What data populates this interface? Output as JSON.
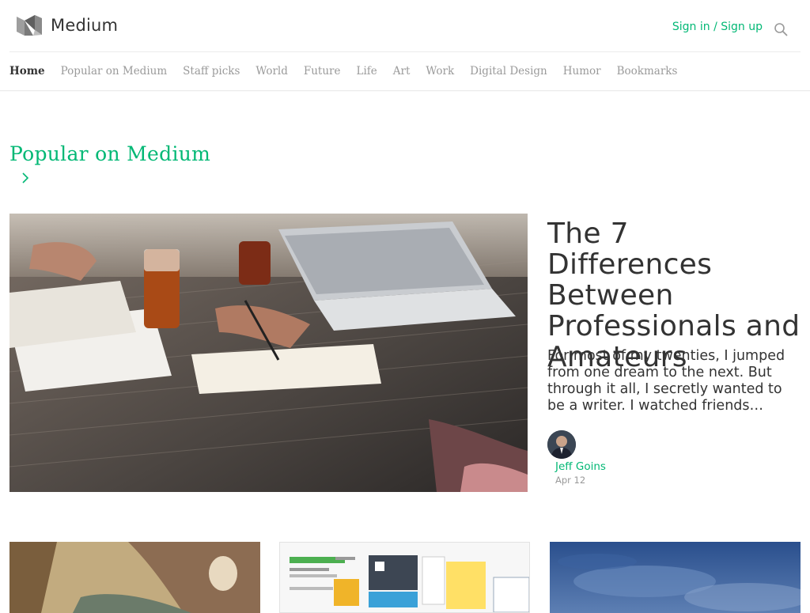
{
  "header": {
    "brand": "Medium",
    "signin_label": "Sign in / Sign up",
    "icons": {
      "logo": "medium-logo-icon",
      "search": "search-icon"
    }
  },
  "nav": {
    "items": [
      {
        "label": "Home",
        "active": true
      },
      {
        "label": "Popular on Medium"
      },
      {
        "label": "Staff picks"
      },
      {
        "label": "World"
      },
      {
        "label": "Future"
      },
      {
        "label": "Life"
      },
      {
        "label": "Art"
      },
      {
        "label": "Work"
      },
      {
        "label": "Digital Design"
      },
      {
        "label": "Humor"
      },
      {
        "label": "Bookmarks"
      }
    ]
  },
  "section": {
    "title": "Popular on Medium",
    "chevron_icon": "chevron-right-icon"
  },
  "featured": {
    "title": "The 7 Differences Between Professionals and Amateurs",
    "excerpt": "For most of my twenties, I jumped from one dream to the next. But through it all, I secretly wanted to be a writer. I watched friends…",
    "author": "Jeff Goins",
    "date": "Apr 12"
  },
  "colors": {
    "accent": "#02b875",
    "text": "#333333",
    "nav_inactive": "#9a9a9a"
  }
}
